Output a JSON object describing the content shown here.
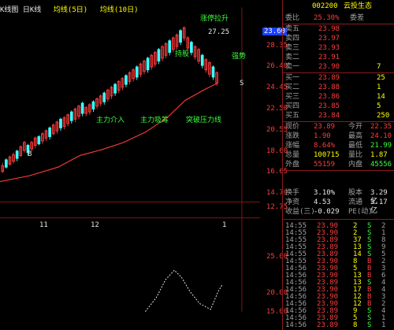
{
  "indicators": {
    "title": "K线图 日K线",
    "ma1_label": "均线(5日)",
    "ma2_label": "均线(10日)"
  },
  "annotations": {
    "high_price": "27.25",
    "last_marker": "23.60",
    "buy_signal_1": "B",
    "signal_texts": [
      "涨停拉升",
      "持股",
      "强势",
      "主力介入",
      "主力吸筹",
      "突破压力线"
    ],
    "sell_signal": "S"
  },
  "price_axis": {
    "ticks": [
      "28.35",
      "26.40",
      "24.45",
      "22.50",
      "20.55",
      "18.60",
      "16.65",
      "14.70",
      "12.75"
    ]
  },
  "date_axis": {
    "labels": [
      "11",
      "12",
      "1"
    ]
  },
  "sub_axis": {
    "ticks": [
      "25.00",
      "20.00",
      "15.00"
    ]
  },
  "quote": {
    "code": "002200",
    "name": "云投生态",
    "weibi_label": "委比",
    "weibi_value": "25.30%",
    "weicha_label": "委差",
    "weicha_value": "",
    "asks": [
      {
        "label": "卖五",
        "price": "23.98",
        "vol": ""
      },
      {
        "label": "卖四",
        "price": "23.97",
        "vol": ""
      },
      {
        "label": "卖三",
        "price": "23.93",
        "vol": ""
      },
      {
        "label": "卖二",
        "price": "23.91",
        "vol": ""
      },
      {
        "label": "卖一",
        "price": "23.90",
        "vol": "7"
      }
    ],
    "bids": [
      {
        "label": "买一",
        "price": "23.89",
        "vol": "25"
      },
      {
        "label": "买二",
        "price": "23.88",
        "vol": "1"
      },
      {
        "label": "买三",
        "price": "23.86",
        "vol": "14"
      },
      {
        "label": "买四",
        "price": "23.85",
        "vol": "5"
      },
      {
        "label": "买五",
        "price": "23.84",
        "vol": "250"
      }
    ],
    "stats": [
      {
        "l1": "现价",
        "v1": "23.89",
        "l2": "今开",
        "v2": "22.35"
      },
      {
        "l1": "涨跌",
        "v1": "1.90",
        "l2": "最高",
        "v2": "24.10"
      },
      {
        "l1": "涨幅",
        "v1": "8.64%",
        "l2": "最低",
        "v2": "21.99"
      },
      {
        "l1": "总量",
        "v1": "100715",
        "l2": "量比",
        "v2": "1.87"
      },
      {
        "l1": "外盘",
        "v1": "55159",
        "l2": "内盘",
        "v2": "45556"
      }
    ],
    "stats2": [
      {
        "l1": "换手",
        "v1": "3.10%",
        "l2": "股本",
        "v2": "3.29亿"
      },
      {
        "l1": "净资",
        "v1": "4.53",
        "l2": "流通",
        "v2": "3.17亿"
      },
      {
        "l1": "收益(三)",
        "v1": "-0.029",
        "l2": "PE(动)",
        "v2": ""
      }
    ],
    "ticks": [
      {
        "t": "14:55",
        "p": "23.90",
        "v": "2",
        "s": "S",
        "n": "2"
      },
      {
        "t": "14:55",
        "p": "23.90",
        "v": "2",
        "s": "S",
        "n": "1"
      },
      {
        "t": "14:55",
        "p": "23.89",
        "v": "37",
        "s": "S",
        "n": "8"
      },
      {
        "t": "14:55",
        "p": "23.89",
        "v": "13",
        "s": "S",
        "n": "9"
      },
      {
        "t": "14:55",
        "p": "23.89",
        "v": "14",
        "s": "S",
        "n": "5"
      },
      {
        "t": "14:55",
        "p": "23.90",
        "v": "8",
        "s": "B",
        "n": "2"
      },
      {
        "t": "14:56",
        "p": "23.90",
        "v": "5",
        "s": "B",
        "n": "3"
      },
      {
        "t": "14:56",
        "p": "23.90",
        "v": "13",
        "s": "B",
        "n": "6"
      },
      {
        "t": "14:56",
        "p": "23.89",
        "v": "13",
        "s": "S",
        "n": "4"
      },
      {
        "t": "14:56",
        "p": "23.90",
        "v": "17",
        "s": "B",
        "n": "4"
      },
      {
        "t": "14:56",
        "p": "23.90",
        "v": "12",
        "s": "B",
        "n": "3"
      },
      {
        "t": "14:56",
        "p": "23.90",
        "v": "12",
        "s": "B",
        "n": "2"
      },
      {
        "t": "14:56",
        "p": "23.89",
        "v": "9",
        "s": "S",
        "n": "4"
      },
      {
        "t": "14:56",
        "p": "23.89",
        "v": "5",
        "s": "S",
        "n": "1"
      },
      {
        "t": "14:56",
        "p": "23.89",
        "v": "8",
        "s": "S",
        "n": "1"
      }
    ]
  },
  "colors": {
    "up": "#ff3c3c",
    "down": "#3cff3c",
    "ma": "#ff3c3c",
    "grid": "#8a1a1a",
    "sub_line": "#ffffff"
  }
}
